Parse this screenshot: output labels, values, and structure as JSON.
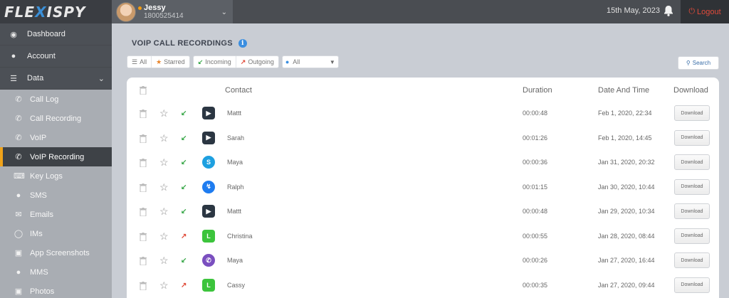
{
  "brand": {
    "logo_text_1": "FLE",
    "logo_x": "X",
    "logo_text_2": "ISPY"
  },
  "user": {
    "name": "Jessy",
    "number": "1800525414"
  },
  "header": {
    "date": "15th May, 2023",
    "logout_label": "Logout"
  },
  "sidebar": {
    "dashboard": "Dashboard",
    "account": "Account",
    "data": "Data",
    "items": [
      {
        "label": "Call Log",
        "icon": "phone-icon"
      },
      {
        "label": "Call Recording",
        "icon": "phone-recording-icon"
      },
      {
        "label": "VoIP",
        "icon": "voip-icon"
      },
      {
        "label": "VoIP Recording",
        "icon": "voip-recording-icon",
        "active": true
      },
      {
        "label": "Key Logs",
        "icon": "keyboard-icon"
      },
      {
        "label": "SMS",
        "icon": "sms-icon"
      },
      {
        "label": "Emails",
        "icon": "email-icon"
      },
      {
        "label": "IMs",
        "icon": "im-icon"
      },
      {
        "label": "App Screenshots",
        "icon": "screenshot-icon"
      },
      {
        "label": "MMS",
        "icon": "mms-icon"
      },
      {
        "label": "Photos",
        "icon": "camera-icon"
      }
    ]
  },
  "page": {
    "title": "VOIP CALL RECORDINGS"
  },
  "filters": {
    "all": "All",
    "starred": "Starred",
    "incoming": "Incoming",
    "outgoing": "Outgoing",
    "app_select": "All",
    "search": "Search"
  },
  "table": {
    "headers": {
      "contact": "Contact",
      "duration": "Duration",
      "datetime": "Date And Time",
      "download": "Download"
    },
    "download_label": "Download",
    "rows": [
      {
        "direction": "incoming",
        "app": "facetime",
        "contact": "Mattt",
        "duration": "00:00:48",
        "datetime": "Feb 1, 2020, 22:34"
      },
      {
        "direction": "incoming",
        "app": "facetime",
        "contact": "Sarah",
        "duration": "00:01:26",
        "datetime": "Feb 1, 2020, 14:45"
      },
      {
        "direction": "incoming",
        "app": "skype",
        "contact": "Maya",
        "duration": "00:00:36",
        "datetime": "Jan 31, 2020, 20:32"
      },
      {
        "direction": "incoming",
        "app": "messenger",
        "contact": "Ralph",
        "duration": "00:01:15",
        "datetime": "Jan 30, 2020, 10:44"
      },
      {
        "direction": "incoming",
        "app": "facetime",
        "contact": "Mattt",
        "duration": "00:00:48",
        "datetime": "Jan 29, 2020, 10:34"
      },
      {
        "direction": "outgoing",
        "app": "line",
        "contact": "Christina",
        "duration": "00:00:55",
        "datetime": "Jan 28, 2020, 08:44"
      },
      {
        "direction": "incoming",
        "app": "viber",
        "contact": "Maya",
        "duration": "00:00:26",
        "datetime": "Jan 27, 2020, 16:44"
      },
      {
        "direction": "outgoing",
        "app": "line",
        "contact": "Cassy",
        "duration": "00:00:35",
        "datetime": "Jan 27, 2020, 09:44"
      }
    ]
  },
  "colors": {
    "accent": "#f0a31a",
    "incoming": "#3aa84a",
    "outgoing": "#e04b3a",
    "logout": "#e04a3a"
  }
}
